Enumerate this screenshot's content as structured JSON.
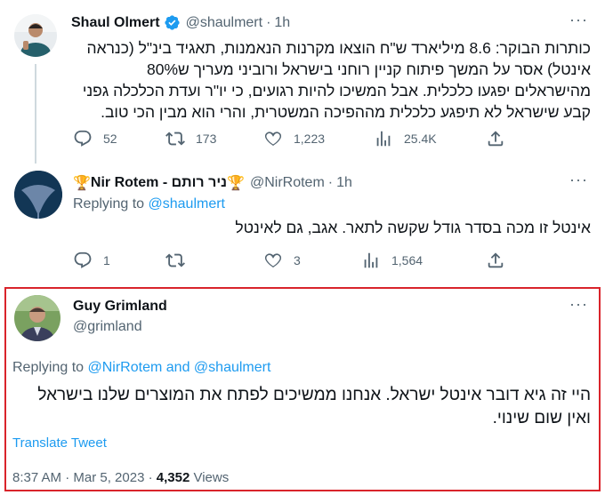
{
  "tweet1": {
    "name": "Shaul Olmert",
    "handle": "@shaulmert",
    "time": "1h",
    "text": "כותרות הבוקר: 8.6 מיליארד ש\"ח הוצאו מקרנות הנאמנות, תאגיד בינ\"ל (כנראה אינטל) אסר על המשך פיתוח קניין רוחני בישראל ורוביני מעריך ש80% מהישראלים יפגעו כלכלית. אבל המשיכו להיות רגועים, כי יו\"ר ועדת הכלכלה גפני קבע שישראל לא תיפגע כלכלית מההפיכה המשטרית, והרי הוא מבין הכי טוב.",
    "replies": "52",
    "retweets": "173",
    "likes": "1,223",
    "views": "25.4K"
  },
  "tweet2": {
    "name": "Nir Rotem - ניר רותם",
    "handle": "@NirRotem",
    "time": "1h",
    "replying_prefix": "Replying to",
    "replying_to": "@shaulmert",
    "text": "אינטל זו מכה בסדר גודל שקשה לתאר. אגב, גם לאינטל",
    "replies": "1",
    "retweets": "",
    "likes": "3",
    "views": "1,564"
  },
  "tweet3": {
    "name": "Guy Grimland",
    "handle": "@grimland",
    "replying_prefix": "Replying to",
    "replying_to_1": "@NirRotem",
    "replying_and": "and",
    "replying_to_2": "@shaulmert",
    "text": "היי זה גיא דובר אינטל ישראל. אנחנו ממשיכים לפתח את המוצרים שלנו בישראל ואין שום שינוי.",
    "translate": "Translate Tweet",
    "timestamp": "8:37 AM · Mar 5, 2023 · ",
    "views_count": "4,352",
    "views_label": "Views"
  },
  "icons": [
    "reply-icon",
    "retweet-icon",
    "like-icon",
    "views-icon",
    "share-icon",
    "verified-icon",
    "trophy-icon",
    "more-icon"
  ],
  "colors": {
    "accent": "#1d9bf0",
    "muted": "#536471",
    "highlight_border": "#d9242b"
  }
}
